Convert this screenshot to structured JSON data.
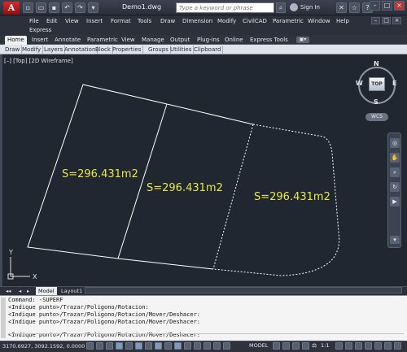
{
  "app": {
    "title": "Demo1.dwg",
    "logo_letter": "A",
    "search_placeholder": "Type a keyword or phrase",
    "sign_in": "Sign In",
    "quick_access": [
      "new-icon",
      "open-icon",
      "save-icon",
      "undo-icon",
      "redo-icon",
      "dropdown-icon"
    ]
  },
  "menu": {
    "items": [
      "File",
      "Edit",
      "View",
      "Insert",
      "Format",
      "Tools",
      "Draw",
      "Dimension",
      "Modify",
      "CivilCAD",
      "Parametric",
      "Window",
      "Help",
      "Express"
    ]
  },
  "ribbon": {
    "tabs": [
      "Home",
      "Insert",
      "Annotate",
      "Parametric",
      "View",
      "Manage",
      "Output",
      "Plug-ins",
      "Online",
      "Express Tools"
    ],
    "active_tab": "Home",
    "panels": [
      "Draw",
      "Modify",
      "Layers",
      "Annotation",
      "Block",
      "Properties",
      "Groups",
      "Utilities",
      "Clipboard"
    ]
  },
  "viewport": {
    "label": "[–] [Top] [2D Wireframe]",
    "ucs_x": "X",
    "ucs_y": "Y"
  },
  "drawing": {
    "areas": [
      "S=296.431m2",
      "S=296.431m2",
      "S=296.431m2"
    ],
    "line_color": "#ffffff",
    "text_color": "#e8e843"
  },
  "viewcube": {
    "face": "TOP",
    "north": "N",
    "south": "S",
    "east": "E",
    "west": "W",
    "wcs": "WCS"
  },
  "layout_tabs": [
    "Model",
    "Layout1"
  ],
  "active_layout": "Model",
  "command": {
    "lines": [
      "Command: -SUPERF",
      "<Indique punto>/Trazar/Poligono/Rotacion:",
      "<Indique punto>/Trazar/Poligono/Rotacion/Mover/Deshacer:",
      "<Indique punto>/Trazar/Poligono/Rotacion/Mover/Deshacer:",
      "",
      "<Indique punto>/Trazar/Poligono/Rotacion/Mover/Deshacer:"
    ]
  },
  "status": {
    "coords": "3170.6927, 3092.1592, 0.0000",
    "model": "MODEL",
    "scale": "1:1"
  }
}
